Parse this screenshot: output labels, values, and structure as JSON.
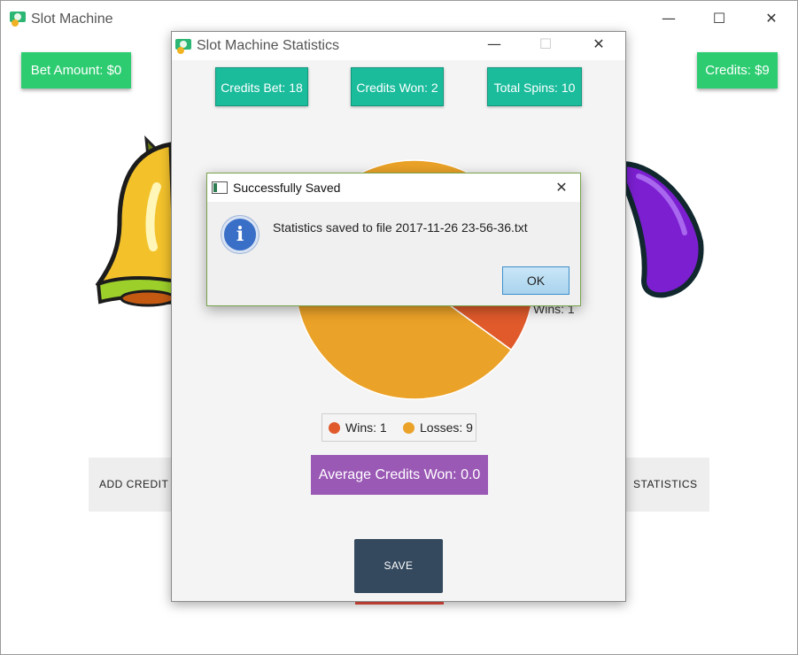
{
  "main_window": {
    "title": "Slot Machine",
    "bet_amount": "Bet Amount: $0",
    "credits": "Credits: $9",
    "add_credit_label": "ADD CREDIT",
    "statistics_label": "STATISTICS",
    "controls": {
      "minimize": "—",
      "maximize": "☐",
      "close": "✕"
    }
  },
  "stats_window": {
    "title": "Slot Machine Statistics",
    "credits_bet": "Credits Bet: 18",
    "credits_won": "Credits Won: 2",
    "total_spins": "Total Spins: 10",
    "pie_label_wins": "Wins: 1",
    "average_credits_won": "Average Credits Won: 0.0",
    "save_label": "SAVE",
    "controls": {
      "minimize": "—",
      "maximize": "☐",
      "close": "✕"
    }
  },
  "chart_data": {
    "type": "pie",
    "series": [
      {
        "name": "Wins",
        "value": 1,
        "color": "#e05a2b"
      },
      {
        "name": "Losses",
        "value": 9,
        "color": "#eba228"
      }
    ],
    "legend": [
      "Wins: 1",
      "Losses: 9"
    ],
    "legend_placement": "bottom"
  },
  "dialog": {
    "title": "Successfully Saved",
    "message": "Statistics saved to file 2017-11-26 23-56-36.txt",
    "ok_label": "OK",
    "close": "✕"
  },
  "colors": {
    "green": "#2ecc71",
    "teal": "#1abc9c",
    "purple": "#9b59b6",
    "navy": "#34495e",
    "red": "#e74c3c"
  }
}
